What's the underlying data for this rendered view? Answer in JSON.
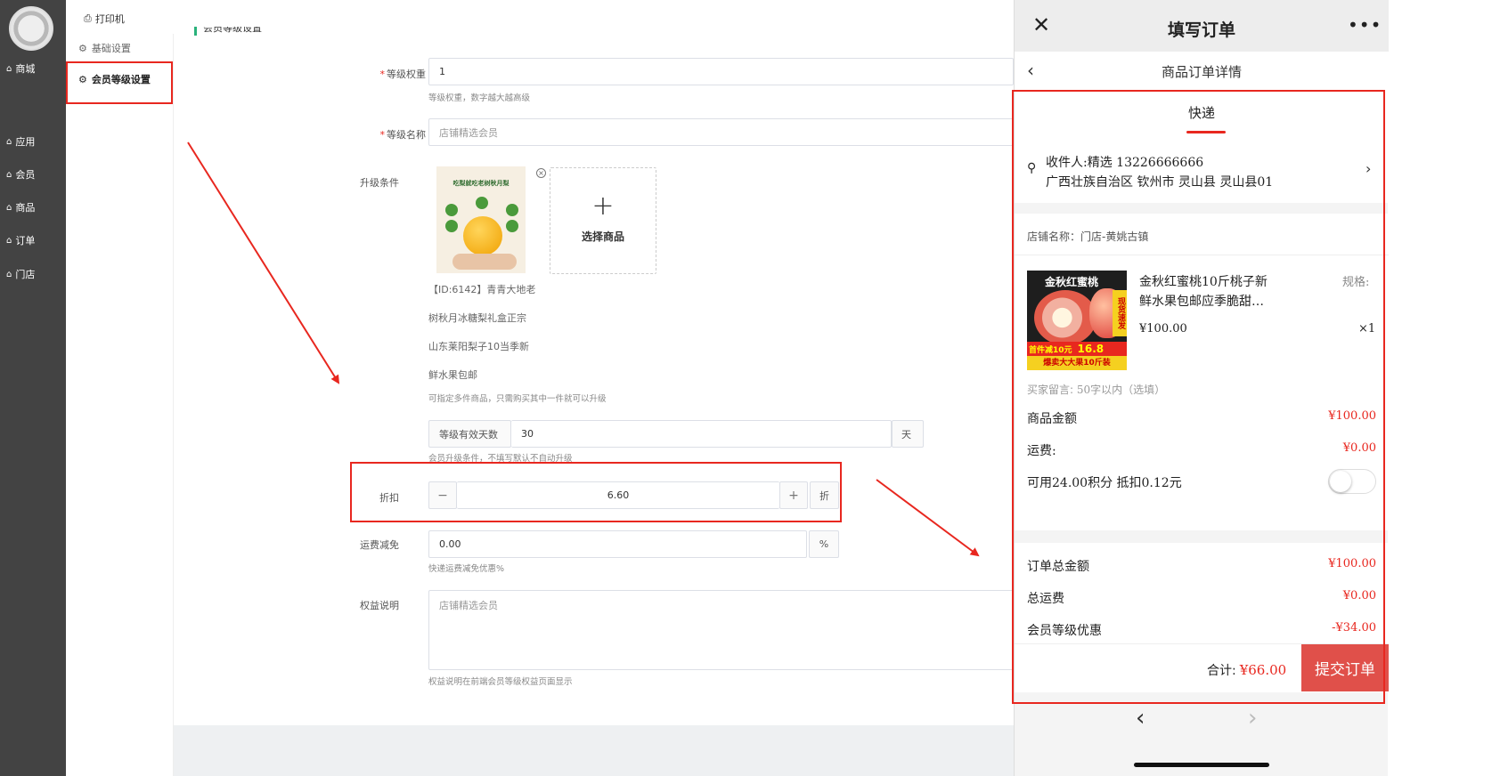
{
  "nav": {
    "items": [
      {
        "label": "商城"
      },
      {
        "label": "应用"
      },
      {
        "label": "会员"
      },
      {
        "label": "商品"
      },
      {
        "label": "订单"
      },
      {
        "label": "门店"
      }
    ]
  },
  "topbar": {
    "print_label": "打印机"
  },
  "submenu": {
    "basic": "基础设置",
    "level": "会员等级设置"
  },
  "form": {
    "section_title": "会员等级设置",
    "weight": {
      "label": "等级权重",
      "value": "1",
      "hint": "等级权重，数字越大越高级"
    },
    "name": {
      "label": "等级名称",
      "placeholder": "店铺精选会员"
    },
    "upgrade": {
      "label": "升级条件",
      "product_id_line": "【ID:6142】青青大地老",
      "lines": [
        "树秋月冰糖梨礼盒正宗",
        "山东莱阳梨子10当季新",
        "鲜水果包邮"
      ],
      "hint": "可指定多件商品，只需购买其中一件就可以升级",
      "select_label": "选择商品",
      "image_title": "吃梨就吃老树秋月梨"
    },
    "validity": {
      "prefix": "等级有效天数",
      "value": "30",
      "suffix": "天",
      "hint": "会员升级条件，不填写默认不自动升级"
    },
    "discount": {
      "label": "折扣",
      "value": "6.60",
      "suffix": "折"
    },
    "freight": {
      "label": "运费减免",
      "value": "0.00",
      "suffix": "%",
      "hint": "快递运费减免优惠%"
    },
    "rights": {
      "label": "权益说明",
      "placeholder": "店铺精选会员",
      "hint": "权益说明在前端会员等级权益页面显示"
    }
  },
  "phone": {
    "title": "填写订单",
    "subtitle": "商品订单详情",
    "tab": "快递",
    "receiver": "收件人:精选 13226666666",
    "address": "广西壮族自治区 钦州市 灵山县 灵山县01",
    "store": "店铺名称：门店-黄姚古镇",
    "product": {
      "title_line1": "金秋红蜜桃10斤桃子新",
      "title_line2": "鲜水果包邮应季脆甜…",
      "spec": "规格:",
      "price": "¥100.00",
      "qty": "×1",
      "image_text_top": "金秋红蜜桃",
      "image_text_promo": "首件减10元",
      "image_text_price": "16.8",
      "image_text_bottom": "爆卖大大果10斤装",
      "image_badge": "现货速发"
    },
    "remark": {
      "label": "买家留言:",
      "placeholder": "50字以内（选填）"
    },
    "goods_amount": {
      "label": "商品金额",
      "value": "¥100.00"
    },
    "freight": {
      "label": "运费:",
      "value": "¥0.00"
    },
    "points": {
      "label": "可用24.00积分 抵扣0.12元"
    },
    "order_total": {
      "label": "订单总金额",
      "value": "¥100.00"
    },
    "total_freight": {
      "label": "总运费",
      "value": "¥0.00"
    },
    "member_discount": {
      "label": "会员等级优惠",
      "value": "-¥34.00"
    },
    "sum": {
      "label": "合计:",
      "value": "¥66.00"
    },
    "submit": "提交订单"
  },
  "colors": {
    "accent_red": "#e8271f",
    "nav_bg": "#434343",
    "submit_bg": "#e0504a"
  }
}
